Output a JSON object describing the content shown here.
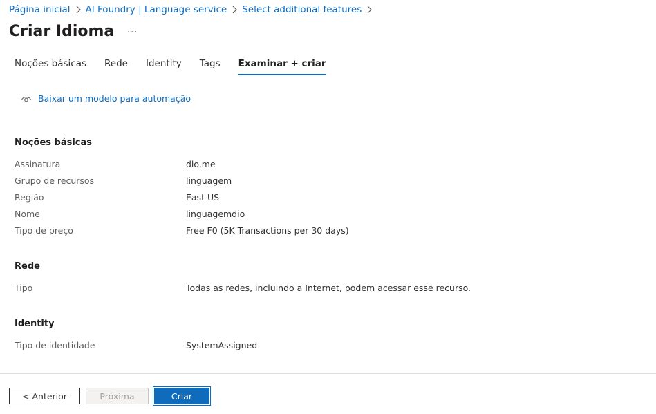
{
  "breadcrumb": [
    {
      "label": "Página inicial"
    },
    {
      "label": "AI Foundry | Language service"
    },
    {
      "label": "Select additional features"
    }
  ],
  "page_title": "Criar Idioma",
  "more_label": "...",
  "tabs": [
    {
      "label": "Noções básicas",
      "active": false
    },
    {
      "label": "Rede",
      "active": false
    },
    {
      "label": "Identity",
      "active": false
    },
    {
      "label": "Tags",
      "active": false
    },
    {
      "label": "Examinar + criar",
      "active": true
    }
  ],
  "download_link": {
    "label": "Baixar um modelo para automação",
    "icon": "eye-icon"
  },
  "sections": [
    {
      "heading": "Noções básicas",
      "rows": [
        {
          "label": "Assinatura",
          "value": "dio.me"
        },
        {
          "label": "Grupo de recursos",
          "value": "linguagem"
        },
        {
          "label": "Região",
          "value": "East US"
        },
        {
          "label": "Nome",
          "value": "linguagemdio"
        },
        {
          "label": "Tipo de preço",
          "value": "Free F0 (5K Transactions per 30 days)"
        }
      ]
    },
    {
      "heading": "Rede",
      "rows": [
        {
          "label": "Tipo",
          "value": "Todas as redes, incluindo a Internet, podem acessar esse recurso."
        }
      ]
    },
    {
      "heading": "Identity",
      "rows": [
        {
          "label": "Tipo de identidade",
          "value": "SystemAssigned"
        }
      ]
    }
  ],
  "footer": {
    "previous_label": "< Anterior",
    "next_label": "Próxima",
    "create_label": "Criar"
  },
  "colors": {
    "accent": "#0f6cbd",
    "text": "#323130",
    "muted": "#605e5c"
  }
}
